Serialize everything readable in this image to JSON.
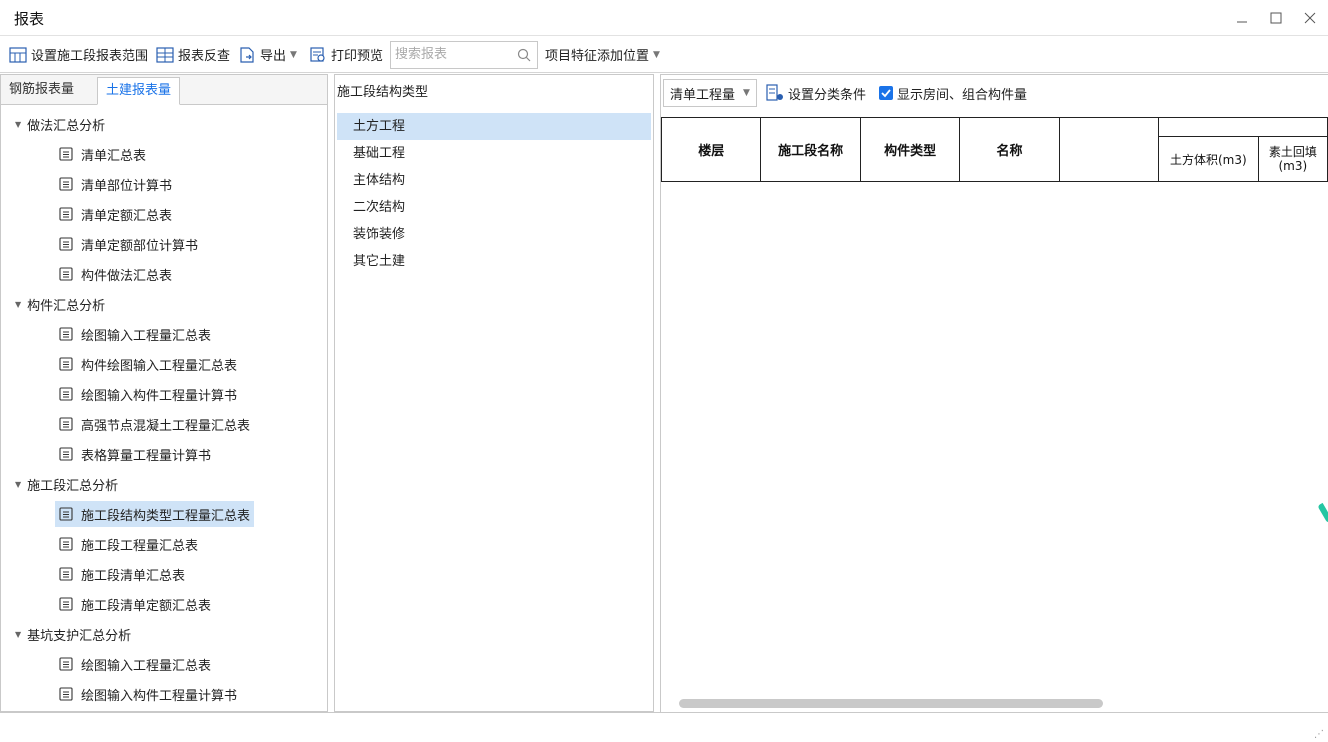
{
  "window": {
    "title": "报表"
  },
  "toolbar": {
    "set_range_label": "设置施工段报表范围",
    "reverse_check_label": "报表反查",
    "export_label": "导出",
    "print_preview_label": "打印预览",
    "search_placeholder": "搜索报表",
    "feature_position_label": "项目特征添加位置"
  },
  "left_tabs": [
    "钢筋报表量",
    "土建报表量"
  ],
  "left_tree": {
    "groups": [
      {
        "label": "做法汇总分析",
        "items": [
          "清单汇总表",
          "清单部位计算书",
          "清单定额汇总表",
          "清单定额部位计算书",
          "构件做法汇总表"
        ]
      },
      {
        "label": "构件汇总分析",
        "items": [
          "绘图输入工程量汇总表",
          "构件绘图输入工程量汇总表",
          "绘图输入构件工程量计算书",
          "高强节点混凝土工程量汇总表",
          "表格算量工程量计算书"
        ]
      },
      {
        "label": "施工段汇总分析",
        "items": [
          "施工段结构类型工程量汇总表",
          "施工段工程量汇总表",
          "施工段清单汇总表",
          "施工段清单定额汇总表"
        ]
      },
      {
        "label": "基坑支护汇总分析",
        "items": [
          "绘图输入工程量汇总表",
          "绘图输入构件工程量计算书"
        ]
      }
    ],
    "selected": "施工段结构类型工程量汇总表"
  },
  "middle": {
    "header": "施工段结构类型",
    "items": [
      "土方工程",
      "基础工程",
      "主体结构",
      "二次结构",
      "装饰装修",
      "其它土建"
    ],
    "selected": "土方工程"
  },
  "right": {
    "quantity_select": "清单工程量",
    "classify_label": "设置分类条件",
    "show_rooms_label": "显示房间、组合构件量",
    "show_rooms_checked": true,
    "columns": [
      "楼层",
      "施工段名称",
      "构件类型",
      "名称"
    ],
    "sub_columns": [
      "土方体积(m3)",
      "素土回填",
      "(m3)"
    ]
  },
  "colors": {
    "accent": "#1a73e8",
    "selection": "#cfe3f7"
  }
}
